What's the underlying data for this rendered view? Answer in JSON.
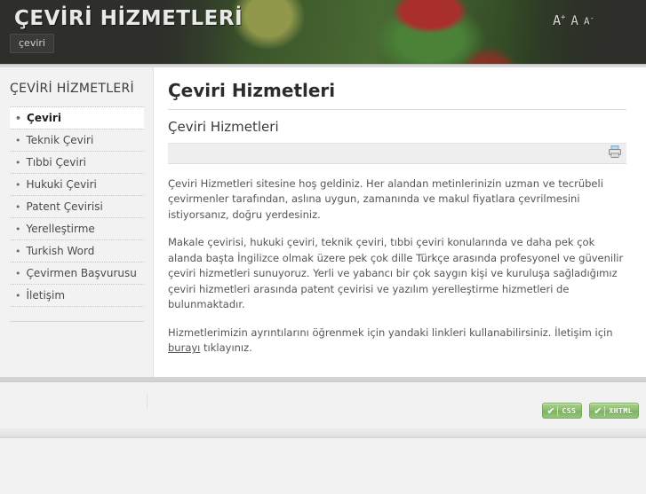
{
  "header": {
    "site_title": "ÇEVİRİ HİZMETLERİ",
    "tabs": [
      {
        "label": "çeviri",
        "active": true
      }
    ],
    "font_sizer": {
      "increase": "A",
      "increase_sign": "+",
      "reset": "A",
      "decrease": "A",
      "decrease_sign": "-"
    }
  },
  "sidebar": {
    "title": "ÇEVİRİ HİZMETLERİ",
    "items": [
      {
        "label": "Çeviri",
        "active": true
      },
      {
        "label": "Teknik Çeviri",
        "active": false
      },
      {
        "label": "Tıbbi Çeviri",
        "active": false
      },
      {
        "label": "Hukuki Çeviri",
        "active": false
      },
      {
        "label": "Patent Çevirisi",
        "active": false
      },
      {
        "label": "Yerelleştirme",
        "active": false
      },
      {
        "label": "Turkish Word",
        "active": false
      },
      {
        "label": "Çevirmen Başvurusu",
        "active": false
      },
      {
        "label": "İletişim",
        "active": false
      }
    ]
  },
  "main": {
    "page_title": "Çeviri Hizmetleri",
    "article_title": "Çeviri Hizmetleri",
    "toolbar": {
      "print_icon": "printer-icon"
    },
    "paragraphs": {
      "p1": "Çeviri Hizmetleri sitesine hoş geldiniz. Her alandan metinlerinizin uzman ve tecrübeli çevirmenler tarafından, aslına uygun, zamanında ve makul fiyatlara çevrilmesini istiyorsanız, doğru yerdesiniz.",
      "p2": "Makale çevirisi, hukuki çeviri, teknik çeviri, tıbbi çeviri konularında ve daha pek çok alanda başta İngilizce olmak üzere pek çok dille Türkçe arasında profesyonel ve güvenilir çeviri hizmetleri sunuyoruz. Yerli ve yabancı bir çok saygın kişi ve kuruluşa sağladığımız çeviri hizmetleri arasında patent çevirisi ve yazılım yerelleştirme hizmetleri de bulunmaktadır.",
      "p3_before": "Hizmetlerimizin ayrıntılarını öğrenmek için yandaki linkleri kullanabilirsiniz. İletişim için ",
      "p3_link": "burayı",
      "p3_after": " tıklayınız."
    }
  },
  "footer": {
    "badges": [
      {
        "check": "✔",
        "label": "CSS"
      },
      {
        "check": "✔",
        "label": "XHTML"
      }
    ]
  },
  "colors": {
    "header_bg": "#2e2e2b",
    "sidebar_bg": "#f2f2f2",
    "content_bg": "#ffffff",
    "badge_green": "#8dbd6e",
    "text": "#555555"
  }
}
